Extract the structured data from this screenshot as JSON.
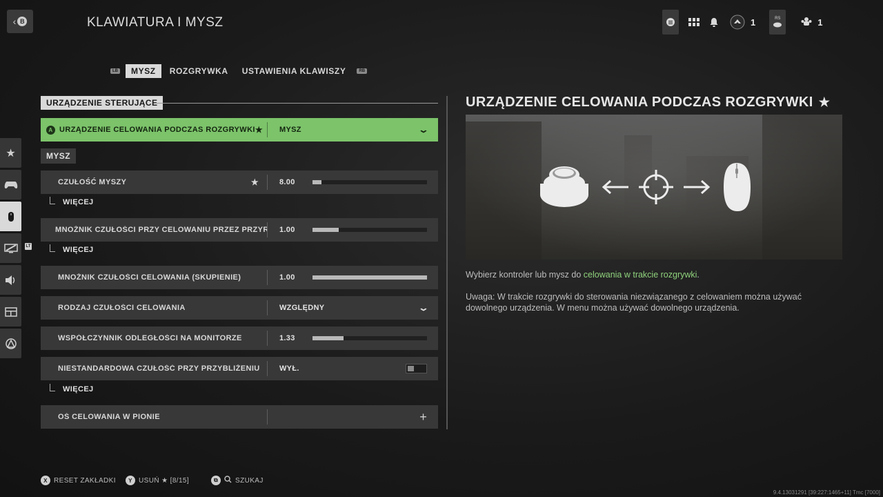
{
  "header": {
    "back_button_glyph": "B",
    "title": "KLAWIATURA I MYSZ",
    "currency_count": "1",
    "party_count": "1",
    "rs_label": "RS"
  },
  "tabs": {
    "lb": "LB",
    "rb": "RB",
    "items": [
      {
        "label": "MYSZ",
        "active": true
      },
      {
        "label": "ROZGRYWKA",
        "active": false
      },
      {
        "label": "USTAWIENIA KLAWISZY",
        "active": false
      }
    ]
  },
  "sidebar": {
    "items": [
      {
        "icon": "star-icon",
        "glyph": "★"
      },
      {
        "icon": "controller-icon",
        "glyph": "🎮"
      },
      {
        "icon": "mouse-icon",
        "glyph": "🖱"
      },
      {
        "icon": "display-icon",
        "glyph": "▰"
      },
      {
        "icon": "speaker-icon",
        "glyph": "🔊"
      },
      {
        "icon": "interface-icon",
        "glyph": "▤"
      },
      {
        "icon": "network-icon",
        "glyph": "◬"
      }
    ],
    "badge": "LT"
  },
  "settings": {
    "section_label": "URZĄDZENIE STERUJĄCE",
    "subsection_label": "MYSZ",
    "aim_device": {
      "btn": "A",
      "label": "URZĄDZENIE CELOWANIA PODCZAS ROZGRYWKI",
      "value": "MYSZ"
    },
    "mouse_sensitivity": {
      "label": "CZUŁOŚĆ MYSZY",
      "value": "8.00",
      "fill": 0.08
    },
    "more_1": "WIĘCEJ",
    "ads_multiplier": {
      "label": "MNOŻNIK CZUŁOŚCI PRZY CELOWANIU PRZEZ PRZYR.",
      "value": "1.00",
      "fill": 0.23
    },
    "more_2": "WIĘCEJ",
    "ads_focus": {
      "label": "MNOŻNIK CZUŁOŚCI CELOWANIA (SKUPIENIE)",
      "value": "1.00",
      "fill": 1.0
    },
    "sens_type": {
      "label": "RODZAJ CZUŁOŚCI CELOWANIA",
      "value": "WZGLĘDNY"
    },
    "monitor_distance": {
      "label": "WSPÓŁCZYNNIK ODLEGŁOŚCI NA MONITORZE",
      "value": "1.33",
      "fill": 0.27
    },
    "custom_zoom": {
      "label": "NIESTANDARDOWA CZUŁOŚĆ PRZY PRZYBLIŻENIU",
      "value": "WYŁ."
    },
    "more_3": "WIĘCEJ",
    "vertical_axis": {
      "label": "OŚ CELOWANIA W PIONIE",
      "value": "+"
    }
  },
  "detail": {
    "title": "URZĄDZENIE CELOWANIA PODCZAS ROZGRYWKI",
    "desc_before": "Wybierz kontroler lub mysz do ",
    "desc_highlight": "celowania w trakcie rozgrywki",
    "desc_after": ".",
    "note": "Uwaga: W trakcie rozgrywki do sterowania niezwiązanego z celowaniem można używać dowolnego urządzenia. W menu można używać dowolnego urządzenia."
  },
  "footer": {
    "reset_btn": "X",
    "reset_label": "RESET ZAKŁADKI",
    "remove_btn": "Y",
    "remove_label": "USUŃ ★ [8/15]",
    "search_label": "SZUKAJ",
    "build": "9.4.13031291 [39:227:1465+11] Tmc [7000]"
  },
  "colors": {
    "highlight": "#7cc36a",
    "link": "#8fd27c",
    "row_bg": "#383838"
  }
}
